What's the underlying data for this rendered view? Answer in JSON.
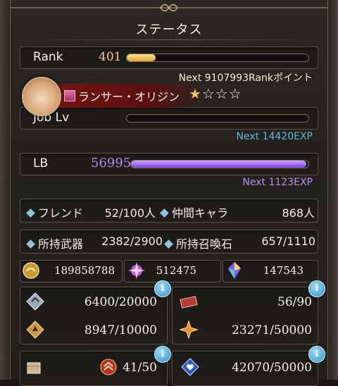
{
  "title": "ステータス",
  "rank": {
    "label": "Rank",
    "value": "401",
    "progress": 0.16,
    "next": "Next 9107993Rankポイント"
  },
  "job": {
    "name": "ランサー・オリジン",
    "stars_filled": 1,
    "stars_total": 4,
    "label": "Job Lv",
    "progress": 0.0,
    "next": "Next 14420EXP"
  },
  "lb": {
    "label": "LB",
    "value": "56995",
    "progress": 0.99,
    "next": "Next 1123EXP"
  },
  "social": [
    {
      "label": "フレンド",
      "value": "52/100人"
    },
    {
      "label": "仲間キャラ",
      "value": "868人"
    },
    {
      "label": "所持武器",
      "value": "2382/2900"
    },
    {
      "label": "所持召喚石",
      "value": "657/1110"
    }
  ],
  "currency": [
    {
      "icon": "rupie-coin-icon",
      "value": "189858788"
    },
    {
      "icon": "crystal-orb-icon",
      "value": "512475"
    },
    {
      "icon": "rainbow-crystal-icon",
      "value": "147543"
    }
  ],
  "resources": [
    {
      "icon": "silver-shield-icon",
      "value": "6400/20000"
    },
    {
      "icon": "ticket-icon",
      "value": "56/90"
    },
    {
      "icon": "gold-shield-icon",
      "value": "8947/10000"
    },
    {
      "icon": "spark-star-icon",
      "value": "23271/50000"
    },
    {
      "icon": "box-icon",
      "value": ""
    },
    {
      "icon": "rank-chevron-icon",
      "value": "41/50"
    },
    {
      "icon": "blue-heart-icon",
      "value": "42070/50000"
    }
  ],
  "info_icon": "i",
  "colors": {
    "rank_bar": "#f2c44a",
    "lb_bar": "#9b5cf0",
    "exp_text": "#5fb6dd",
    "lb_text": "#b78cf0",
    "next_text": "#f2ecd9"
  }
}
